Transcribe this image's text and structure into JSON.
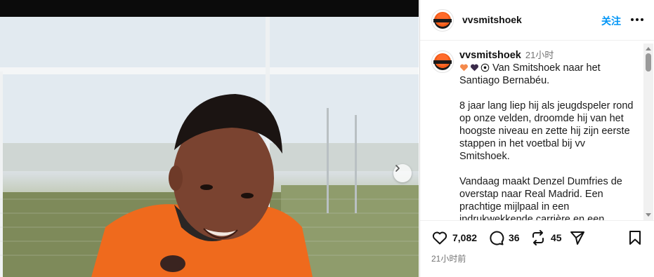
{
  "post": {
    "username": "vvsmitshoek",
    "follow_label": "关注",
    "more_label": "More options",
    "caption": {
      "username": "vvsmitshoek",
      "time": "21小时",
      "emojis": [
        "orange-heart",
        "black-heart",
        "soccer-ball"
      ],
      "paragraphs": [
        "Van Smitshoek naar het Santiago Bernabéu.",
        "8 jaar lang liep hij als jeugdspeler rond op onze velden, droomde hij van het hoogste niveau en zette hij zijn eerste stappen in het voetbal bij vv Smitshoek.",
        "Vandaag maakt Denzel Dumfries de overstap naar Real Madrid. Een prachtige mijlpaal in een indrukwekkende carrière en een"
      ]
    },
    "stats": {
      "likes": "7,082",
      "comments": "36",
      "reposts": "45"
    },
    "timestamp": "21小时前"
  },
  "icons": {
    "next": "chevron-right-icon",
    "more": "ellipsis-icon",
    "like": "heart-icon",
    "comment": "comment-icon",
    "repost": "repost-icon",
    "share": "send-icon",
    "save": "bookmark-icon"
  },
  "colors": {
    "follow": "#0095f6",
    "orange_heart": "#f4894b",
    "black_heart": "#3a2a4a",
    "jersey": "#ef6a1d"
  }
}
